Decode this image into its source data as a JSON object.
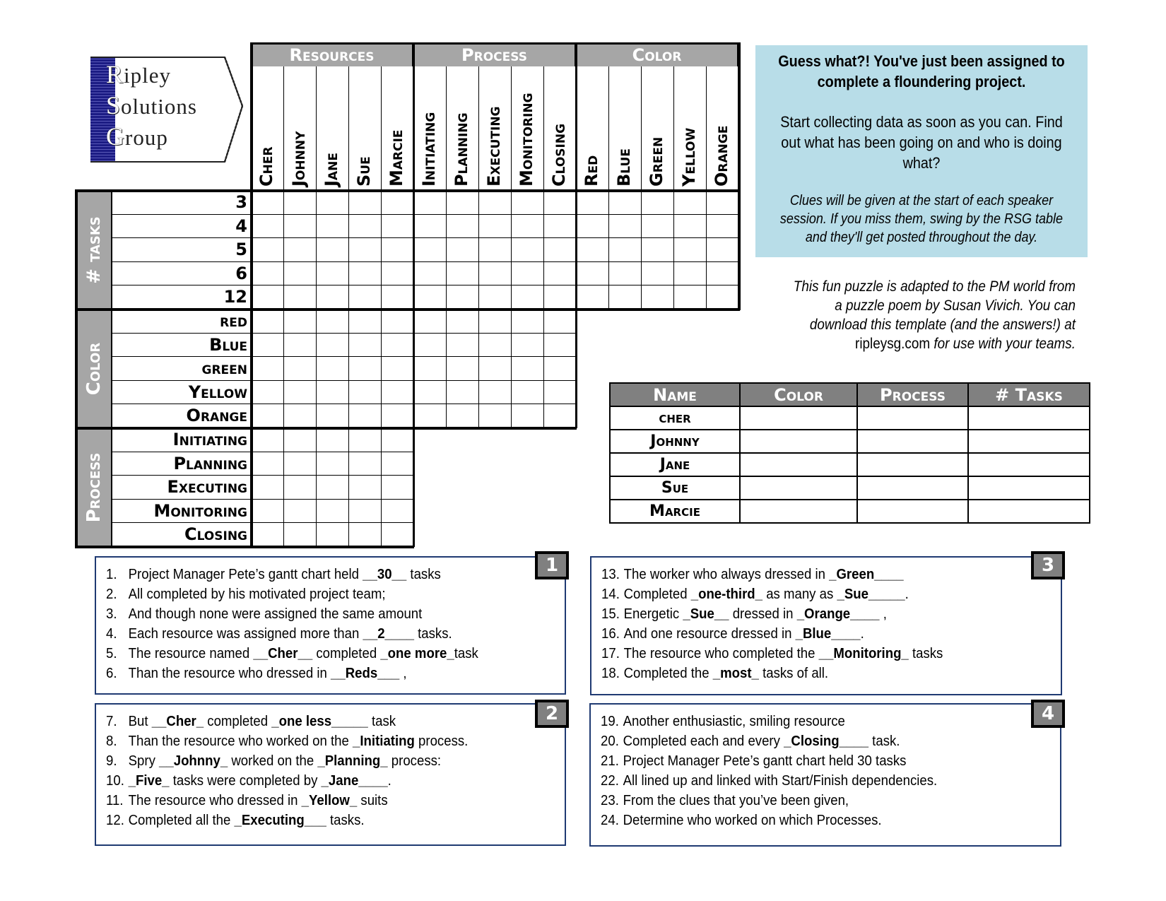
{
  "logo": {
    "lines": [
      {
        "cap": "R",
        "rest": "ipley"
      },
      {
        "cap": "S",
        "rest": "olutions"
      },
      {
        "cap": "G",
        "rest": "roup"
      }
    ]
  },
  "grid": {
    "column_groups": [
      {
        "label": "Resources",
        "items": [
          "Cher",
          "Johnny",
          "Jane",
          "Sue",
          "Marcie"
        ]
      },
      {
        "label": "Process",
        "items": [
          "Initiating",
          "Planning",
          "Executing",
          "Monitoring",
          "Closing"
        ]
      },
      {
        "label": "Color",
        "items": [
          "Red",
          "Blue",
          "Green",
          "Yellow",
          "Orange"
        ]
      }
    ],
    "row_groups": [
      {
        "label": "# tasks",
        "items": [
          "3",
          "4",
          "5",
          "6",
          "12"
        ]
      },
      {
        "label": "Color",
        "items": [
          "red",
          "Blue",
          "green",
          "Yellow",
          "Orange"
        ]
      },
      {
        "label": "Process",
        "items": [
          "Initiating",
          "Planning",
          "Executing",
          "Monitoring",
          "Closing"
        ]
      }
    ]
  },
  "info": {
    "headline": "Guess what?! You've just been assigned to complete a floundering project.",
    "body": "Start collecting data as soon as you can.  Find out what has been going on and who is doing what?",
    "note": "Clues will be given at the start of each speaker session.  If you miss them, swing by the RSG table and they'll get posted throughout the day."
  },
  "credit": {
    "text_a": "This fun puzzle is adapted to the PM world from a puzzle poem by Susan Vivich.  You can download this template (and the answers!) at ",
    "link": "ripleysg.com",
    "text_b": " for use with your teams."
  },
  "answer_table": {
    "headers": [
      "Name",
      "Color",
      "Process",
      "# Tasks"
    ],
    "names": [
      "cher",
      "Johnny",
      "Jane",
      "Sue",
      "Marcie"
    ]
  },
  "clue_boxes": [
    {
      "badge": "1",
      "clues": [
        {
          "n": "1.",
          "parts": [
            [
              "Project Manager Pete’s gantt chart held ",
              0
            ],
            [
              "__30__",
              1
            ],
            [
              " tasks",
              0
            ]
          ]
        },
        {
          "n": "2.",
          "parts": [
            [
              "All completed by his motivated project team;",
              0
            ]
          ]
        },
        {
          "n": "3.",
          "parts": [
            [
              "And though none were assigned the same amount",
              0
            ]
          ]
        },
        {
          "n": "4.",
          "parts": [
            [
              "Each resource was assigned more than ",
              0
            ],
            [
              "__2____",
              1
            ],
            [
              " tasks.",
              0
            ]
          ]
        },
        {
          "n": "5.",
          "parts": [
            [
              "The resource named ",
              0
            ],
            [
              "__Cher__",
              1
            ],
            [
              " completed ",
              0
            ],
            [
              "_one more_",
              1
            ],
            [
              "task",
              0
            ]
          ]
        },
        {
          "n": "6.",
          "parts": [
            [
              "Than the resource who dressed in ",
              0
            ],
            [
              "__Reds___",
              1
            ],
            [
              " ,",
              0
            ]
          ]
        }
      ]
    },
    {
      "badge": "2",
      "clues": [
        {
          "n": "7.",
          "parts": [
            [
              "But ",
              0
            ],
            [
              "__Cher_",
              1
            ],
            [
              " completed ",
              0
            ],
            [
              "_one less_____",
              1
            ],
            [
              " task",
              0
            ]
          ]
        },
        {
          "n": "8.",
          "parts": [
            [
              "Than the resource who worked on the ",
              0
            ],
            [
              "_Initiating",
              1
            ],
            [
              " process.",
              0
            ]
          ]
        },
        {
          "n": "9.",
          "parts": [
            [
              "Spry  ",
              0
            ],
            [
              "__Johnny_",
              1
            ],
            [
              " worked on the ",
              0
            ],
            [
              "_Planning_",
              1
            ],
            [
              " process:",
              0
            ]
          ]
        },
        {
          "n": "10.",
          "parts": [
            [
              "_Five_",
              1
            ],
            [
              " tasks were completed by ",
              0
            ],
            [
              "_Jane____",
              1
            ],
            [
              ".",
              0
            ]
          ]
        },
        {
          "n": "11.",
          "parts": [
            [
              "The resource who dressed in ",
              0
            ],
            [
              "_Yellow_",
              1
            ],
            [
              " suits",
              0
            ]
          ]
        },
        {
          "n": "12.",
          "parts": [
            [
              "Completed all the ",
              0
            ],
            [
              "_Executing___",
              1
            ],
            [
              " tasks.",
              0
            ]
          ]
        }
      ]
    },
    {
      "badge": "3",
      "clues": [
        {
          "n": "13.",
          "parts": [
            [
              "The worker who always dressed in ",
              0
            ],
            [
              "_Green____",
              1
            ]
          ]
        },
        {
          "n": "14.",
          "parts": [
            [
              "Completed ",
              0
            ],
            [
              "_one-third_",
              1
            ],
            [
              " as many as ",
              0
            ],
            [
              "_Sue_____",
              1
            ],
            [
              ".",
              0
            ]
          ]
        },
        {
          "n": "15.",
          "parts": [
            [
              "Energetic ",
              0
            ],
            [
              "_Sue__",
              1
            ],
            [
              " dressed in ",
              0
            ],
            [
              "_Orange____",
              1
            ],
            [
              " ,",
              0
            ]
          ]
        },
        {
          "n": "16.",
          "parts": [
            [
              "And one resource dressed in ",
              0
            ],
            [
              "_Blue____",
              1
            ],
            [
              ".",
              0
            ]
          ]
        },
        {
          "n": "17.",
          "parts": [
            [
              "The resource who completed the ",
              0
            ],
            [
              "__Monitoring_",
              1
            ],
            [
              " tasks",
              0
            ]
          ]
        },
        {
          "n": "18.",
          "parts": [
            [
              "Completed the ",
              0
            ],
            [
              "_most_",
              1
            ],
            [
              " tasks of all.",
              0
            ]
          ]
        }
      ]
    },
    {
      "badge": "4",
      "clues": [
        {
          "n": "19.",
          "parts": [
            [
              "Another enthusiastic, smiling resource",
              0
            ]
          ]
        },
        {
          "n": "20.",
          "parts": [
            [
              "Completed each and every ",
              0
            ],
            [
              "_Closing____",
              1
            ],
            [
              " task.",
              0
            ]
          ]
        },
        {
          "n": "21.",
          "parts": [
            [
              "Project Manager Pete’s gantt chart held 30 tasks",
              0
            ]
          ]
        },
        {
          "n": "22.",
          "parts": [
            [
              "All lined up and linked with Start/Finish dependencies.",
              0
            ]
          ]
        },
        {
          "n": "23.",
          "parts": [
            [
              "From the clues that you’ve been given,",
              0
            ]
          ]
        },
        {
          "n": "24.",
          "parts": [
            [
              "Determine who worked on which Processes.",
              0
            ]
          ]
        }
      ]
    }
  ]
}
